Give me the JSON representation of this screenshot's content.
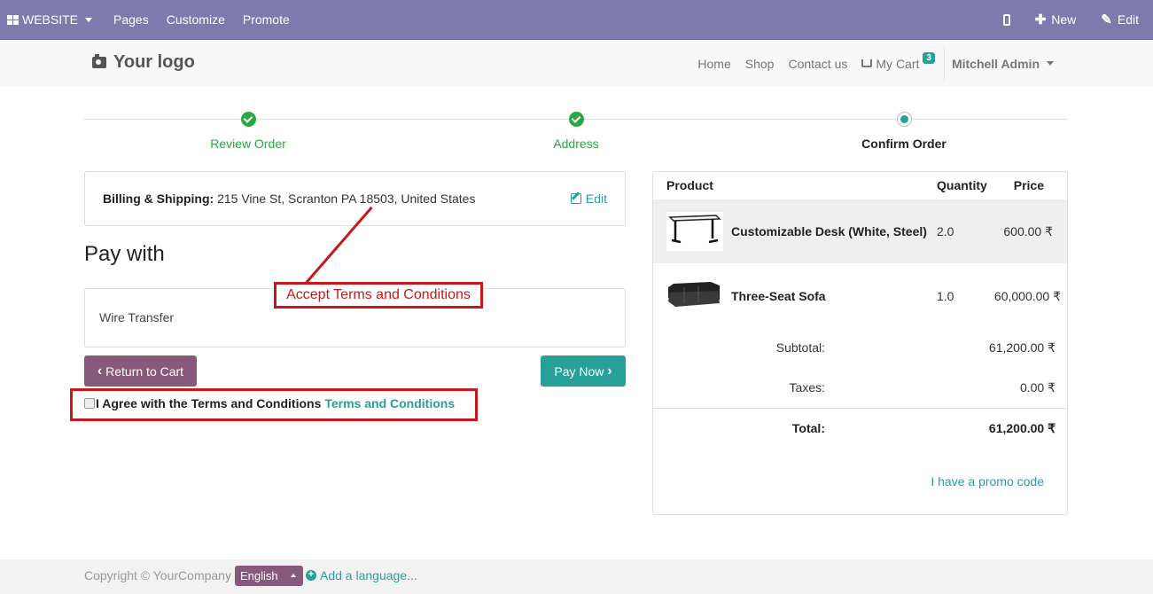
{
  "topbar": {
    "website_label": "WEBSITE",
    "menu": [
      "Pages",
      "Customize",
      "Promote"
    ],
    "new_label": "New",
    "edit_label": "Edit"
  },
  "header": {
    "logo_text": "Your logo",
    "nav": [
      "Home",
      "Shop",
      "Contact us"
    ],
    "cart_label": "My Cart",
    "cart_count": "3",
    "user_name": "Mitchell Admin"
  },
  "wizard": {
    "steps": [
      {
        "label": "Review Order",
        "state": "done"
      },
      {
        "label": "Address",
        "state": "done"
      },
      {
        "label": "Confirm Order",
        "state": "current"
      }
    ]
  },
  "billing": {
    "label": "Billing & Shipping:",
    "address": "215 Vine St, Scranton PA 18503, United States",
    "edit_label": "Edit"
  },
  "payment": {
    "heading": "Pay with",
    "option": "Wire Transfer",
    "return_label": "Return to Cart",
    "pay_label": "Pay Now"
  },
  "terms": {
    "agree_text": "I Agree with the Terms and Conditions",
    "link_text": "Terms and Conditions"
  },
  "annotation": {
    "label": "Accept Terms and Conditions"
  },
  "summary": {
    "headers": {
      "product": "Product",
      "quantity": "Quantity",
      "price": "Price"
    },
    "lines": [
      {
        "name": "Customizable Desk (White, Steel)",
        "qty": "2.0",
        "price": "600.00 ₹"
      },
      {
        "name": "Three-Seat Sofa",
        "qty": "1.0",
        "price": "60,000.00 ₹"
      }
    ],
    "subtotal_label": "Subtotal:",
    "subtotal": "61,200.00 ₹",
    "taxes_label": "Taxes:",
    "taxes": "0.00 ₹",
    "total_label": "Total:",
    "total": "61,200.00 ₹",
    "promo_label": "I have a promo code"
  },
  "footer": {
    "copyright": "Copyright © YourCompany",
    "language": "English",
    "add_language": "Add a language..."
  },
  "colors": {
    "admin_bar": "#7c7bad",
    "primary": "#27a09a",
    "secondary": "#875a7b",
    "success": "#28a745",
    "annotation": "#c8161d"
  }
}
